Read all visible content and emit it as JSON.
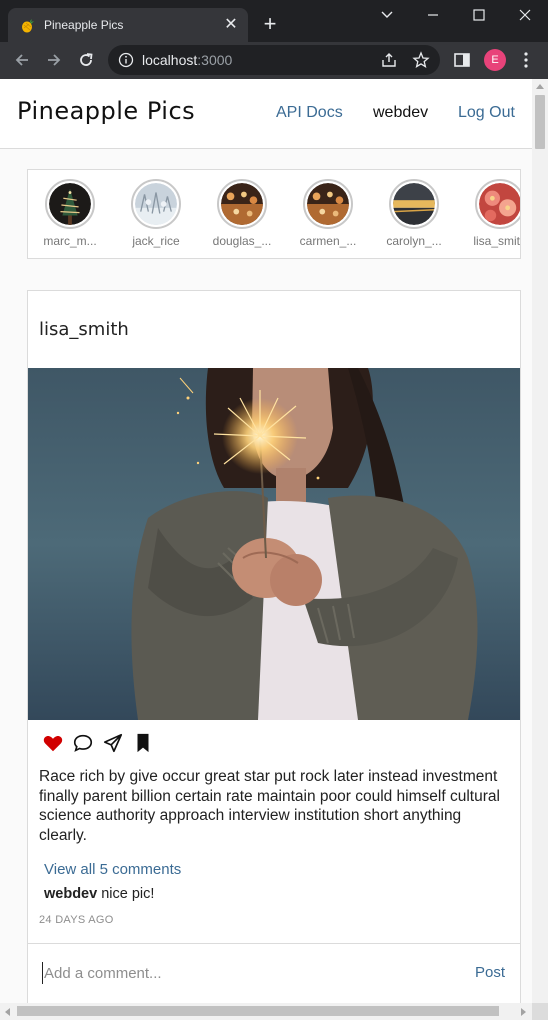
{
  "browser": {
    "tab_title": "Pineapple Pics",
    "tab_close": "✕",
    "new_tab": "+",
    "url_host": "localhost",
    "url_port": ":3000",
    "profile_initial": "E"
  },
  "header": {
    "brand": "Pineapple Pics",
    "nav": {
      "api_docs": "API Docs",
      "username": "webdev",
      "logout": "Log Out"
    }
  },
  "stories": [
    {
      "name": "marc_m...",
      "image": "pine-tree-lights"
    },
    {
      "name": "jack_rice",
      "image": "snowy-forest"
    },
    {
      "name": "douglas_...",
      "image": "bokeh-city"
    },
    {
      "name": "carmen_...",
      "image": "bokeh-city"
    },
    {
      "name": "carolyn_...",
      "image": "sunset-sea"
    },
    {
      "name": "lisa_smith",
      "image": "flowers"
    }
  ],
  "post": {
    "username": "lisa_smith",
    "image": "woman-holding-sparkler",
    "liked": true,
    "caption": "Race rich by give occur great star put rock later instead investment finally parent billion certain rate maintain poor could himself cultural science authority approach interview institution short anything clearly.",
    "view_comments": "View all 5 comments",
    "comments": [
      {
        "user": "webdev",
        "text": "nice pic!"
      }
    ],
    "timestamp": "24 DAYS AGO",
    "comment_placeholder": "Add a comment...",
    "post_label": "Post"
  },
  "colors": {
    "link": "#3b6b94",
    "like": "#d10000",
    "chrome_dark": "#202124",
    "profile": "#e8437a"
  }
}
